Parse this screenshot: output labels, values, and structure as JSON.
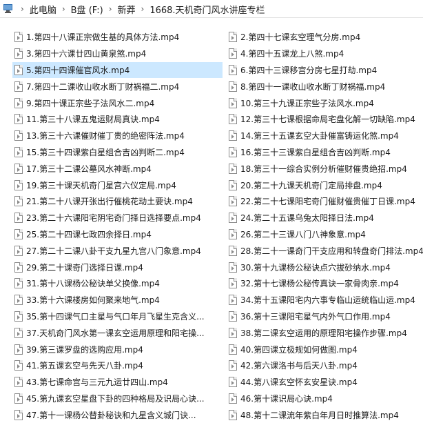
{
  "address_bar": {
    "crumbs": [
      "此电脑",
      "B盘 (F:)",
      "新莽",
      "1668.天机奇门风水讲座专栏"
    ],
    "separator": "›"
  },
  "files_left": [
    "1.第四十八课正宗做生基的具体方法.mp4",
    "3.第四十六课廿四山黄泉煞.mp4",
    "5.第四十四课催官风水.mp4",
    "7.第四十二课收山收水断丁财祸福二.mp4",
    "9.第四十课正宗些子法风水二.mp4",
    "11.第三十八课五鬼运财局真诀.mp4",
    "13.第三十六课催财催丁贵的绝密阵法.mp4",
    "15.第三十四课紫白星组合吉凶判断二.mp4",
    "17.第三十二课公墓风水神断.mp4",
    "19.第三十课天机奇门星宫六仪定局.mp4",
    "21.第二十八课开张出行催桃花动土要诀.mp4",
    "23.第二十六课阳宅阴宅奇门择日选择要点.mp4",
    "25.第二十四课七政四余择日.mp4",
    "27.第二十二课八卦干支九星九宫八门象意.mp4",
    "29.第二十课奇门选择日课.mp4",
    "31.第十八课杨公秘诀单父换像.mp4",
    "33.第十六课楼房如何聚来地气.mp4",
    "35.第十四课气口主星与气口年月飞星生克含义...",
    "37.天机奇门风水第一课玄空运用原理和阳宅操...",
    "39.第三课罗盘的选购应用.mp4",
    "41.第五课玄空与先天八卦.mp4",
    "43.第七课命宫与三元九运廿四山.mp4",
    "45.第九课玄空星盘下卦的四种格局及识局心诀...",
    "47.第十一课杨公替卦秘诀和九星含义城门诀..."
  ],
  "files_right": [
    "2.第四十七课玄空理气分房.mp4",
    "4.第四十五课龙上八煞.mp4",
    "6.第四十三课移宫分房七星打劫.mp4",
    "8.第四十一课收山收水断丁财祸福.mp4",
    "10.第三十九课正宗些子法风水.mp4",
    "12.第三十七课根据命局宅盘化解一切缺陷.mp4",
    "14.第三十五课玄空大卦催富铸运化煞.mp4",
    "16.第三十三课紫白星组合吉凶判断.mp4",
    "18.第三十一综合实例分析催财催贵绝招.mp4",
    "20.第二十九课天机奇门定局排盘.mp4",
    "22.第二十七课阳宅奇门催财催贵催丁日课.mp4",
    "24.第二十五课乌兔太阳择日法.mp4",
    "26.第二十三课八门八神象意.mp4",
    "28.第二十一课奇门干支应用和转盘奇门排法.mp4",
    "30.第十九课杨公秘诀点穴拔砂纳水.mp4",
    "32.第十七课杨公秘传真诀一家骨肉亲.mp4",
    "34.第十五课阳宅内六事专临山运统临山运.mp4",
    "36.第十三课阳宅星气内外气口作用.mp4",
    "38.第二课玄空运用的原理阳宅操作步骤.mp4",
    "40.第四课立极规如何做图.mp4",
    "42.第六课洛书与后天八卦.mp4",
    "44.第八课玄空怀玄安星诀.mp4",
    "46.第十课识局心诀.mp4",
    "48.第十二课流年紫白年月日时推算法.mp4"
  ],
  "selected_file": "5.第四十四课催官风水.mp4",
  "icons": {
    "location": "this-pc-icon",
    "file": "video-file-icon"
  },
  "colors": {
    "selection": "#cce8ff",
    "text": "#1a1a1a"
  }
}
